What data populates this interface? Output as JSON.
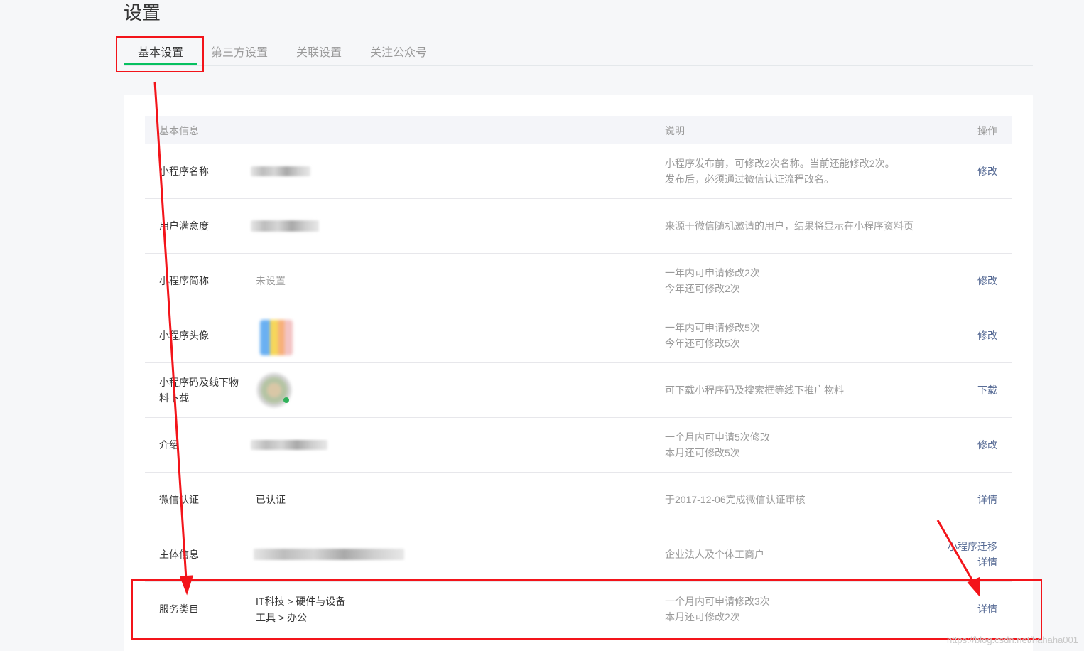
{
  "page": {
    "title": "设置"
  },
  "tabs": [
    {
      "label": "基本设置",
      "active": true
    },
    {
      "label": "第三方设置",
      "active": false
    },
    {
      "label": "关联设置",
      "active": false
    },
    {
      "label": "关注公众号",
      "active": false
    }
  ],
  "table": {
    "headers": {
      "info": "基本信息",
      "desc": "说明",
      "op": "操作"
    },
    "rows": [
      {
        "label": "小程序名称",
        "value": "",
        "desc": [
          "小程序发布前，可修改2次名称。当前还能修改2次。",
          "发布后，必须通过微信认证流程改名。"
        ],
        "ops": [
          "修改"
        ]
      },
      {
        "label": "用户满意度",
        "value": "",
        "desc": [
          "来源于微信随机邀请的用户，结果将显示在小程序资料页"
        ],
        "ops": []
      },
      {
        "label": "小程序简称",
        "value": "未设置",
        "desc": [
          "一年内可申请修改2次",
          "今年还可修改2次"
        ],
        "ops": [
          "修改"
        ]
      },
      {
        "label": "小程序头像",
        "value": "",
        "desc": [
          "一年内可申请修改5次",
          "今年还可修改5次"
        ],
        "ops": [
          "修改"
        ]
      },
      {
        "label": "小程序码及线下物料下载",
        "value": "",
        "desc": [
          "可下载小程序码及搜索框等线下推广物料"
        ],
        "ops": [
          "下载"
        ]
      },
      {
        "label": "介绍",
        "value": "",
        "desc": [
          "一个月内可申请5次修改",
          "本月还可修改5次"
        ],
        "ops": [
          "修改"
        ]
      },
      {
        "label": "微信认证",
        "value": "已认证",
        "desc": [
          "于2017-12-06完成微信认证审核"
        ],
        "ops": [
          "详情"
        ]
      },
      {
        "label": "主体信息",
        "value": "",
        "desc": [
          "企业法人及个体工商户"
        ],
        "ops": [
          "小程序迁移",
          "详情"
        ]
      },
      {
        "label": "服务类目",
        "value_lines": [
          "IT科技 > 硬件与设备",
          "工具 > 办公"
        ],
        "desc": [
          "一个月内可申请修改3次",
          "本月还可修改2次"
        ],
        "ops": [
          "详情"
        ]
      }
    ]
  },
  "watermark": "https://blog.csdn.net/hahaha001",
  "annotation_color": "#f3141a"
}
